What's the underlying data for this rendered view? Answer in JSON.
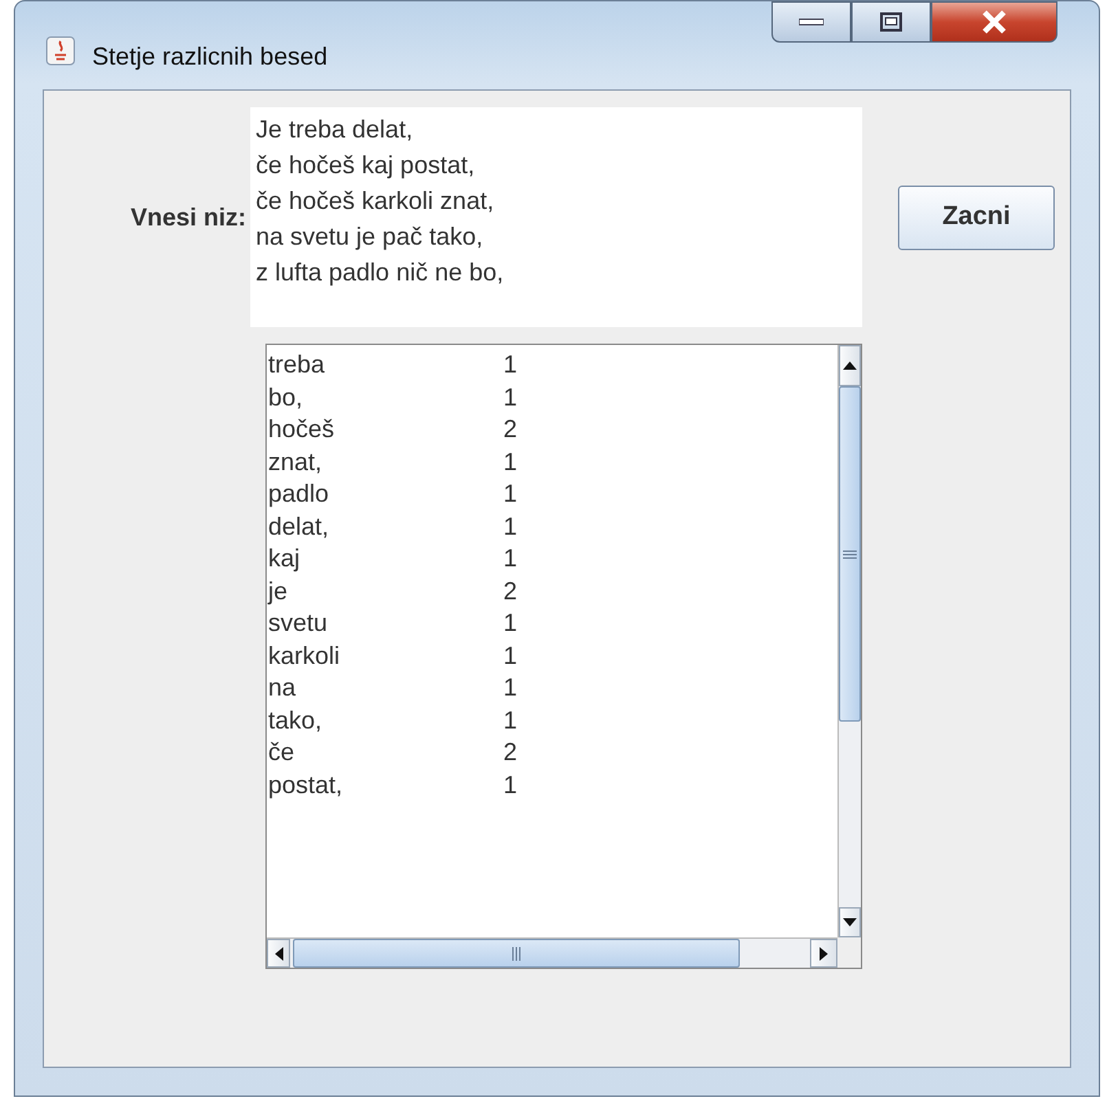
{
  "window": {
    "title": "Stetje razlicnih besed"
  },
  "input": {
    "label": "Vnesi niz:",
    "lines": [
      "Je treba delat,",
      "če hočeš kaj postat,",
      "če hočeš karkoli znat,",
      "na svetu je pač tako,",
      "z lufta padlo nič ne bo,"
    ]
  },
  "button": "Zacni",
  "words": [
    {
      "word": "treba",
      "count": "1"
    },
    {
      "word": "bo,",
      "count": "1"
    },
    {
      "word": "hočeš",
      "count": "2"
    },
    {
      "word": "znat,",
      "count": "1"
    },
    {
      "word": "padlo",
      "count": "1"
    },
    {
      "word": "delat,",
      "count": "1"
    },
    {
      "word": "kaj",
      "count": "1"
    },
    {
      "word": "je",
      "count": "2"
    },
    {
      "word": "svetu",
      "count": "1"
    },
    {
      "word": "karkoli",
      "count": "1"
    },
    {
      "word": "na",
      "count": "1"
    },
    {
      "word": "tako,",
      "count": "1"
    },
    {
      "word": "če",
      "count": "2"
    },
    {
      "word": "postat,",
      "count": "1"
    }
  ]
}
